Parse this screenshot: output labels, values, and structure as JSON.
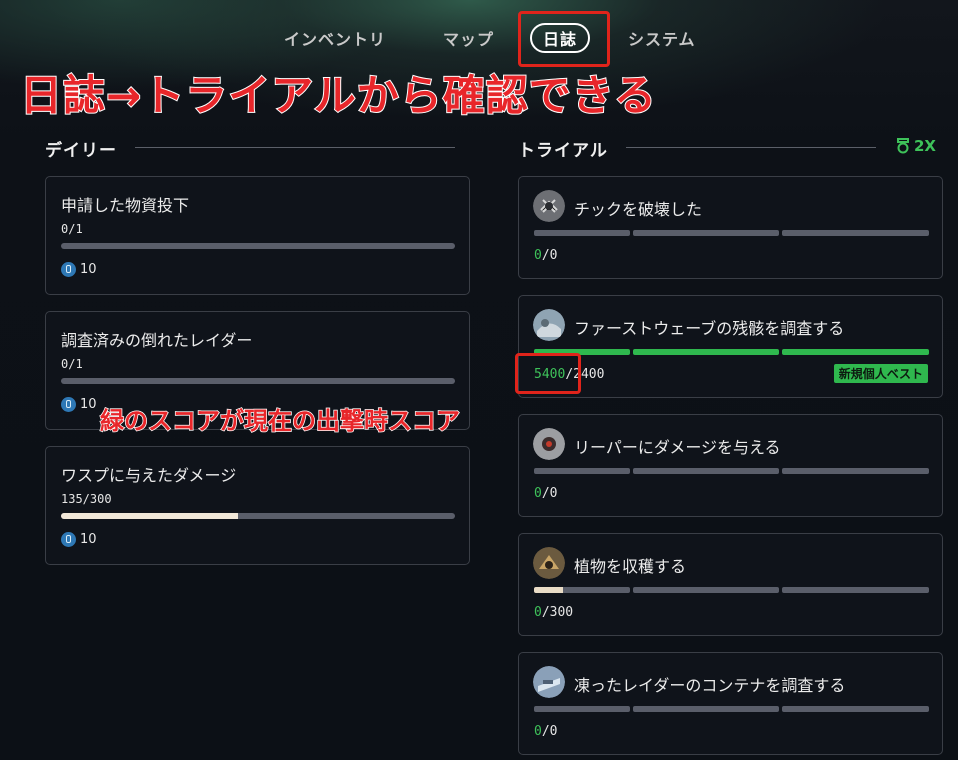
{
  "tabs": [
    {
      "label": "インベントリ"
    },
    {
      "label": "マップ"
    },
    {
      "label": "日誌"
    },
    {
      "label": "システム"
    }
  ],
  "annotation": {
    "title": "日誌→トライアルから確認できる",
    "note": "緑のスコアが現在の出撃時スコア"
  },
  "daily": {
    "heading": "デイリー",
    "cards": [
      {
        "title": "申請した物資投下",
        "progress": "0/1",
        "fraction": 0,
        "reward": "10"
      },
      {
        "title": "調査済みの倒れたレイダー",
        "progress": "0/1",
        "fraction": 0,
        "reward": "10"
      },
      {
        "title": "ワスプに与えたダメージ",
        "progress": "135/300",
        "fraction": 0.45,
        "reward": "10"
      }
    ]
  },
  "trials": {
    "heading": "トライアル",
    "multiplier": "2X",
    "cards": [
      {
        "title": "チックを破壊した",
        "current": "0",
        "target": "/0",
        "fill": 0,
        "full": false
      },
      {
        "title": "ファーストウェーブの残骸を調査する",
        "current": "5400",
        "target": "/2400",
        "fill": 1,
        "full": true,
        "badge": "新規個人ベスト"
      },
      {
        "title": "リーパーにダメージを与える",
        "current": "0",
        "target": "/0",
        "fill": 0,
        "full": false
      },
      {
        "title": "植物を収穫する",
        "current": "0",
        "target": "/300",
        "fill": 0.03,
        "full": false
      },
      {
        "title": "凍ったレイダーのコンテナを調査する",
        "current": "0",
        "target": "/0",
        "fill": 0,
        "full": false
      }
    ]
  },
  "colors": {
    "accent_green": "#3ec25a",
    "annotation_red": "#e8262a",
    "bar_fill": "#f1e7d8"
  }
}
